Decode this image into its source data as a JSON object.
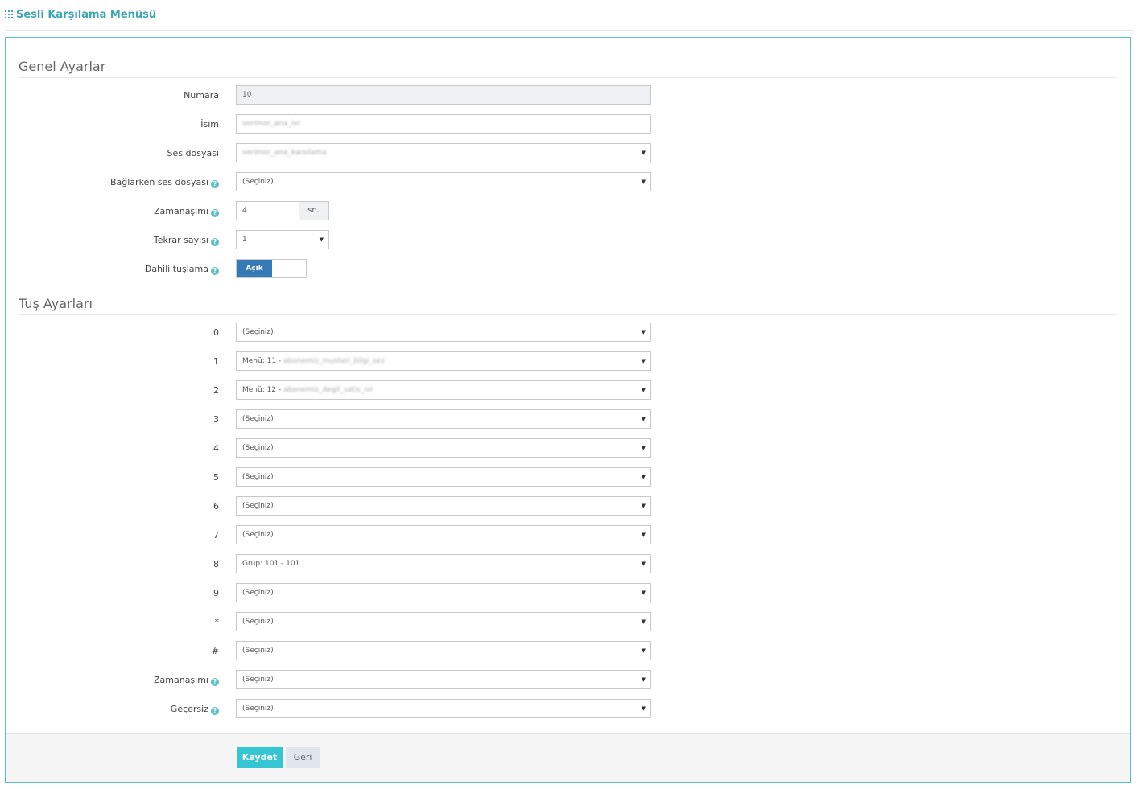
{
  "header": {
    "title": "Sesli Karşılama Menüsü",
    "icon": "grid-icon"
  },
  "general": {
    "section_title": "Genel Ayarlar",
    "number": {
      "label": "Numara",
      "value": "10"
    },
    "name": {
      "label": "İsim",
      "value": "verimor_ana_ivr"
    },
    "sound_file": {
      "label": "Ses dosyası",
      "value": "verimor_ana_karsilama"
    },
    "connect_sound": {
      "label": "Bağlarken ses dosyası",
      "value": "(Seçiniz)"
    },
    "timeout": {
      "label": "Zamanaşımı",
      "value": "4",
      "unit": "sn."
    },
    "repeat": {
      "label": "Tekrar sayısı",
      "value": "1"
    },
    "internal_dial": {
      "label": "Dahili tuşlama",
      "on_label": "Açık"
    }
  },
  "keys": {
    "section_title": "Tuş Ayarları",
    "items": [
      {
        "label": "0",
        "value": "(Seçiniz)"
      },
      {
        "label": "1",
        "value": "Menü: 11 - ",
        "blurred": "abonemiz_musteri_bilgi_ses"
      },
      {
        "label": "2",
        "value": "Menü: 12 - ",
        "blurred": "abonemiz_degil_satis_ivr"
      },
      {
        "label": "3",
        "value": "(Seçiniz)"
      },
      {
        "label": "4",
        "value": "(Seçiniz)"
      },
      {
        "label": "5",
        "value": "(Seçiniz)"
      },
      {
        "label": "6",
        "value": "(Seçiniz)"
      },
      {
        "label": "7",
        "value": "(Seçiniz)"
      },
      {
        "label": "8",
        "value": "Grup: 101 - 101"
      },
      {
        "label": "9",
        "value": "(Seçiniz)"
      },
      {
        "label": "*",
        "value": "(Seçiniz)"
      },
      {
        "label": "#",
        "value": "(Seçiniz)"
      },
      {
        "label": "Zamanaşımı",
        "value": "(Seçiniz)"
      },
      {
        "label": "Geçersiz",
        "value": "(Seçiniz)"
      }
    ]
  },
  "footer": {
    "save_label": "Kaydet",
    "back_label": "Geri"
  },
  "colors": {
    "accent": "#36c6d3",
    "toggle_on": "#337ab7",
    "title": "#3aa5b5"
  }
}
